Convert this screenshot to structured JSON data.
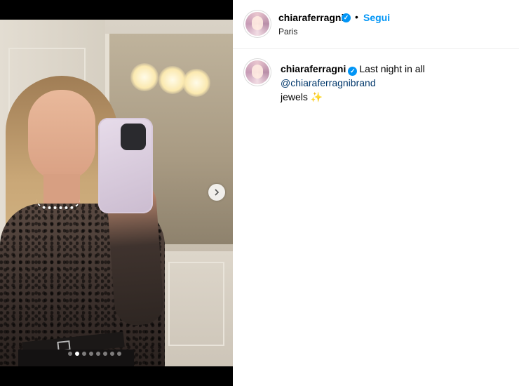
{
  "post": {
    "author": "chiaraferragni",
    "verified_glyph": "✓",
    "follow_separator": "•",
    "follow_label": "Segui",
    "location": "Paris",
    "caption": {
      "author": "chiaraferragni",
      "text_before": "Last night in all ",
      "mention": "@chiaraferragnibrand",
      "text_after": "jewels ✨"
    }
  },
  "media": {
    "slide_count": 8,
    "active_slide": 1,
    "next_icon": "chevron-right-icon"
  }
}
